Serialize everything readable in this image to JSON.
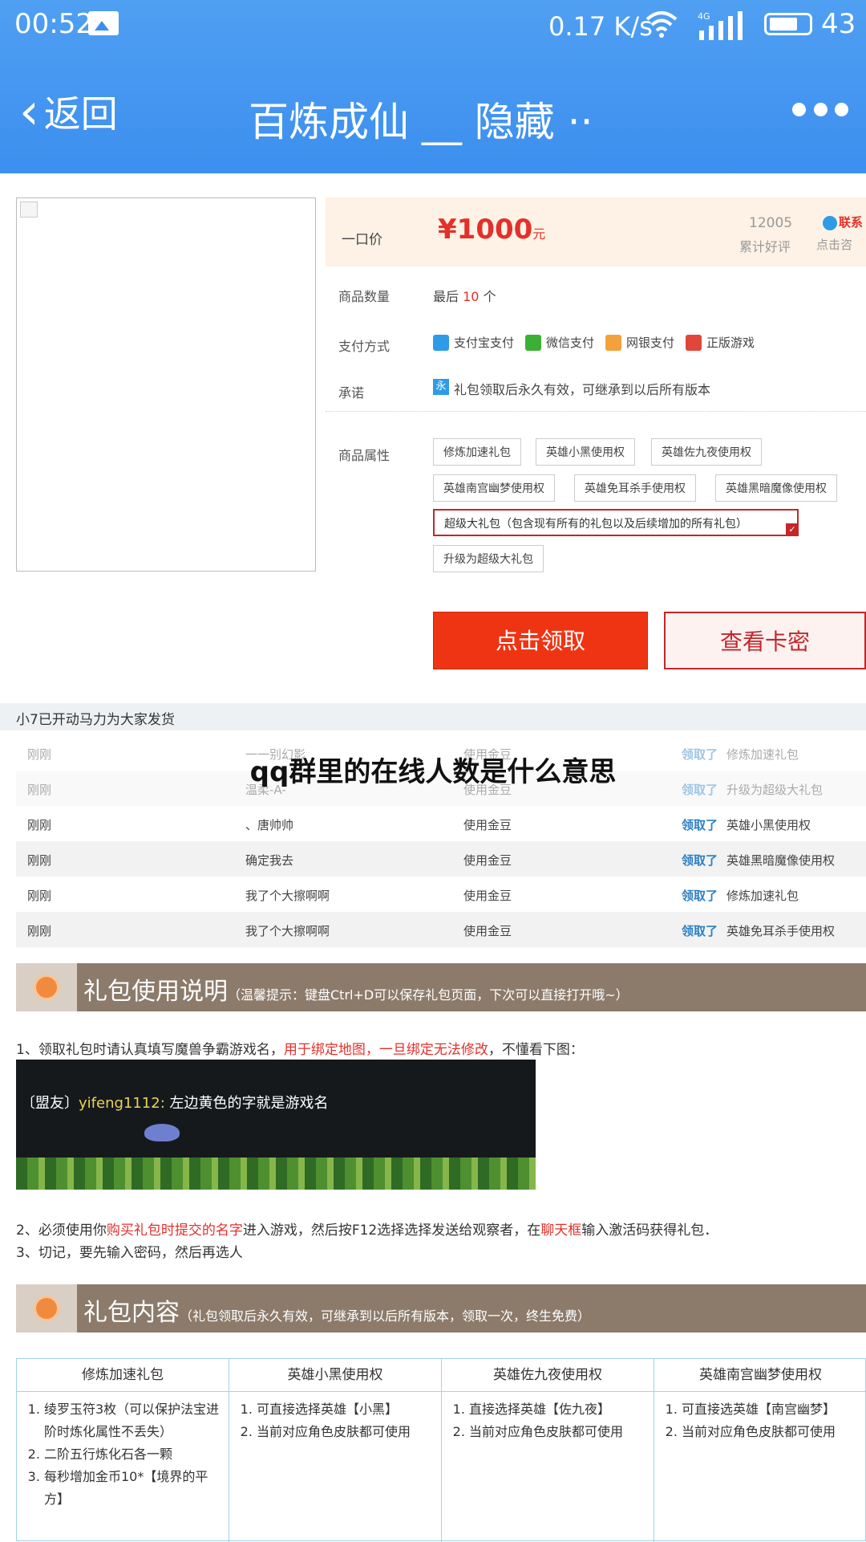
{
  "status_bar": {
    "time": "00:52",
    "speed": "0.17 K/s",
    "battery": "43"
  },
  "nav": {
    "back_label": "返回",
    "title": "百炼成仙 __ 隐藏 ··"
  },
  "price": {
    "label": "一口价",
    "value": "¥1000",
    "unit": "元",
    "review_count": "12005",
    "review_label": "累计好评",
    "contact_label": "联系",
    "contact_hint": "点击咨"
  },
  "quantity": {
    "label": "商品数量",
    "prefix": "最后",
    "count": "10",
    "suffix": "个"
  },
  "payment": {
    "label": "支付方式",
    "options": [
      {
        "name": "支付宝支付",
        "color": "#2e9be6"
      },
      {
        "name": "微信支付",
        "color": "#3cb034"
      },
      {
        "name": "网银支付",
        "color": "#f3a23b"
      },
      {
        "name": "正版游戏",
        "color": "#e0463a"
      }
    ]
  },
  "promise": {
    "label": "承诺",
    "icon_text": "永",
    "text": "礼包领取后永久有效，可继承到以后所有版本"
  },
  "attributes": {
    "label": "商品属性",
    "items": [
      "修炼加速礼包",
      "英雄小黑使用权",
      "英雄佐九夜使用权",
      "英雄南宫幽梦使用权",
      "英雄免耳杀手使用权",
      "英雄黑暗魔像使用权",
      "超级大礼包（包含现有所有的礼包以及后续增加的所有礼包）",
      "升级为超级大礼包"
    ]
  },
  "buttons": {
    "claim": "点击领取",
    "view_card": "查看卡密"
  },
  "activity": {
    "title": "小7已开动马力为大家发货",
    "rows": [
      {
        "time": "刚刚",
        "user": "一一别幻影",
        "method": "使用金豆",
        "action": "领取了",
        "item": "修炼加速礼包"
      },
      {
        "time": "刚刚",
        "user": "温柔-A-",
        "method": "使用金豆",
        "action": "领取了",
        "item": "升级为超级大礼包"
      },
      {
        "time": "刚刚",
        "user": "、唐帅帅",
        "method": "使用金豆",
        "action": "领取了",
        "item": "英雄小黑使用权"
      },
      {
        "time": "刚刚",
        "user": "确定我去",
        "method": "使用金豆",
        "action": "领取了",
        "item": "英雄黑暗魔像使用权"
      },
      {
        "time": "刚刚",
        "user": "我了个大擦啊啊",
        "method": "使用金豆",
        "action": "领取了",
        "item": "修炼加速礼包"
      },
      {
        "time": "刚刚",
        "user": "我了个大擦啊啊",
        "method": "使用金豆",
        "action": "领取了",
        "item": "英雄免耳杀手使用权"
      }
    ]
  },
  "overlay_headline": "qq群里的在线人数是什么意思",
  "usage_section": {
    "title": "礼包使用说明",
    "note": "（温馨提示：键盘Ctrl+D可以保存礼包页面，下次可以直接打开哦~）",
    "step1_a": "1、领取礼包时请认真填写魔兽争霸游戏名，",
    "step1_red": "用于绑定地图，一旦绑定无法修改",
    "step1_b": "，不懂看下图：",
    "game_caption_prefix": "〔盟友〕",
    "game_caption_name": "yifeng1112:",
    "game_caption_text": " 左边黄色的字就是游戏名",
    "step2_a": "2、必须使用你",
    "step2_red1": "购买礼包时提交的名字",
    "step2_b": "进入游戏，然后按F12选择选择发送给观察者，在",
    "step2_red2": "聊天框",
    "step2_c": "输入激活码获得礼包．",
    "step3": "3、切记，要先输入密码，然后再选人"
  },
  "content_section": {
    "title": "礼包内容",
    "note": "（礼包领取后永久有效，可继承到以后所有版本，领取一次，终生免费）",
    "columns": [
      {
        "header": "修炼加速礼包",
        "items": [
          "绫罗玉符3枚（可以保护法宝进阶时炼化属性不丢失）",
          "二阶五行炼化石各一颗",
          "每秒增加金币10*【境界的平方】"
        ]
      },
      {
        "header": "英雄小黑使用权",
        "items": [
          "可直接选择英雄【小黑】",
          "当前对应角色皮肤都可使用"
        ]
      },
      {
        "header": "英雄佐九夜使用权",
        "items": [
          "直接选择英雄【佐九夜】",
          "当前对应角色皮肤都可使用"
        ]
      },
      {
        "header": "英雄南宫幽梦使用权",
        "items": [
          "可直接选英雄【南宫幽梦】",
          "当前对应角色皮肤都可使用"
        ]
      }
    ]
  }
}
